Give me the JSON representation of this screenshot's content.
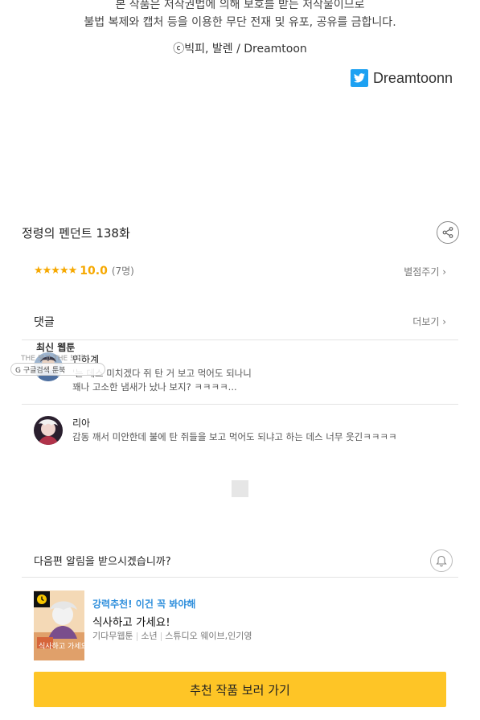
{
  "copyright": {
    "line1": "본 작품은 저작권법에 의해 보호를 받는 저작물이므로",
    "line2": "불법 복제와 캡처 등을 이용한 무단 전재 및 유포, 공유를 금합니다.",
    "credit": "ⓒ빅피, 발렌 / Dreamtoon"
  },
  "twitter": {
    "label": "Dreamtoonn",
    "icon": "twitter-icon",
    "color": "#1da1f2"
  },
  "episode": {
    "title": "정령의 펜던트 138화",
    "share_icon": "share-icon"
  },
  "rating": {
    "stars": "★★★★★",
    "score": "10.0",
    "count": "(7명)",
    "rate_link": "별점주기 ›"
  },
  "comments": {
    "heading": "댓글",
    "more": "더보기 ›",
    "items": [
      {
        "name": "민하계",
        "line1": "'는 데스 미치겠다 쥐 탄 거 보고 먹어도 되나니",
        "line2": "꽤나 고소한 냄새가 났나 보지? ㅋㅋㅋㅋ..."
      },
      {
        "name": "리아",
        "line1": "감동 깨서 미안한데 불에 탄 쥐들을 보고 먹어도 되냐고 하는 데스 너무 웃긴ㅋㅋㅋㅋ",
        "line2": ""
      }
    ]
  },
  "overlay": {
    "title": "최신 웹툰",
    "sub": "THE 보고 THE 보기",
    "bar": "G 구글검색 툰북"
  },
  "notify": {
    "question": "다음편 알림을 받으시겠습니까?",
    "bell_icon": "bell-icon"
  },
  "recommend": {
    "tag": "강력추천! 이건 꼭 봐야해",
    "title": "식사하고 가세요!",
    "meta": [
      "기다무웹툰",
      "소년",
      "스튜디오 웨이브,인기영"
    ],
    "thumb_text": "식사하고 가세요!",
    "badge_icon": "clock-icon",
    "cta": "추천 작품 보러 가기",
    "cta_color": "#fec526"
  }
}
